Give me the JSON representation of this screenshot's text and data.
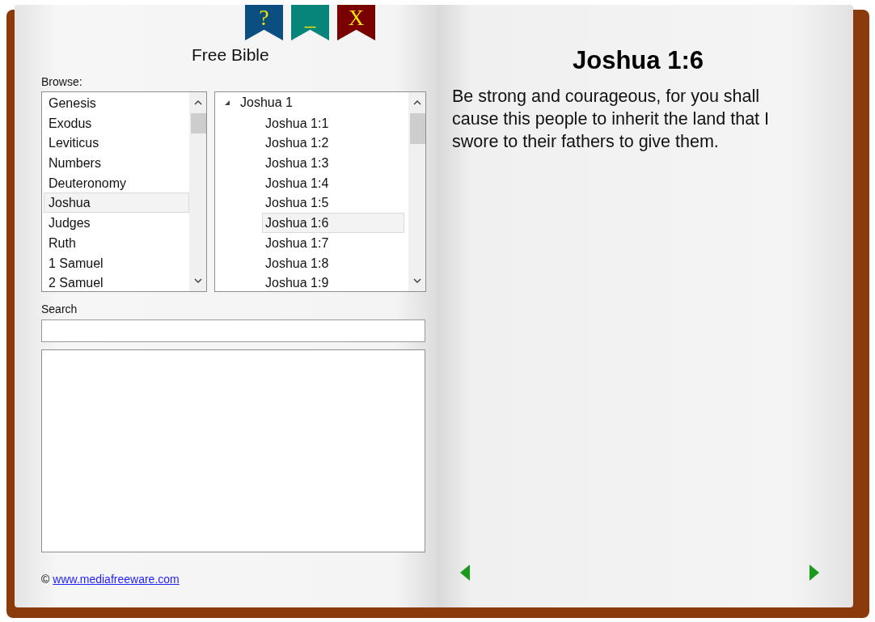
{
  "ribbons": [
    {
      "label": "?",
      "color": "#0b4f80"
    },
    {
      "label": "_",
      "color": "#08857a"
    },
    {
      "label": "X",
      "color": "#7a0000"
    }
  ],
  "title": "Free Bible",
  "browse": {
    "label": "Browse:",
    "books": [
      {
        "label": "Genesis",
        "selected": false
      },
      {
        "label": "Exodus",
        "selected": false
      },
      {
        "label": "Leviticus",
        "selected": false
      },
      {
        "label": "Numbers",
        "selected": false
      },
      {
        "label": "Deuteronomy",
        "selected": false
      },
      {
        "label": "Joshua",
        "selected": true
      },
      {
        "label": "Judges",
        "selected": false
      },
      {
        "label": "Ruth",
        "selected": false
      },
      {
        "label": "1 Samuel",
        "selected": false
      },
      {
        "label": "2 Samuel",
        "selected": false
      }
    ],
    "chapters": [
      {
        "label": "Joshua 1",
        "expanded": true,
        "selected": false,
        "children": [
          {
            "label": "Joshua 1:1",
            "selected": false
          },
          {
            "label": "Joshua 1:2",
            "selected": false
          },
          {
            "label": "Joshua 1:3",
            "selected": false
          },
          {
            "label": "Joshua 1:4",
            "selected": false
          },
          {
            "label": "Joshua 1:5",
            "selected": false
          },
          {
            "label": "Joshua 1:6",
            "selected": true
          },
          {
            "label": "Joshua 1:7",
            "selected": false
          },
          {
            "label": "Joshua 1:8",
            "selected": false
          },
          {
            "label": "Joshua 1:9",
            "selected": false
          }
        ]
      }
    ]
  },
  "search": {
    "label": "Search"
  },
  "footer": {
    "symbol": "©",
    "link": "www.mediafreeware.com"
  },
  "verse": {
    "reference": "Joshua 1:6",
    "text": "Be strong and courageous, for you shall cause this people to inherit the land that I swore to their fathers to give them."
  }
}
